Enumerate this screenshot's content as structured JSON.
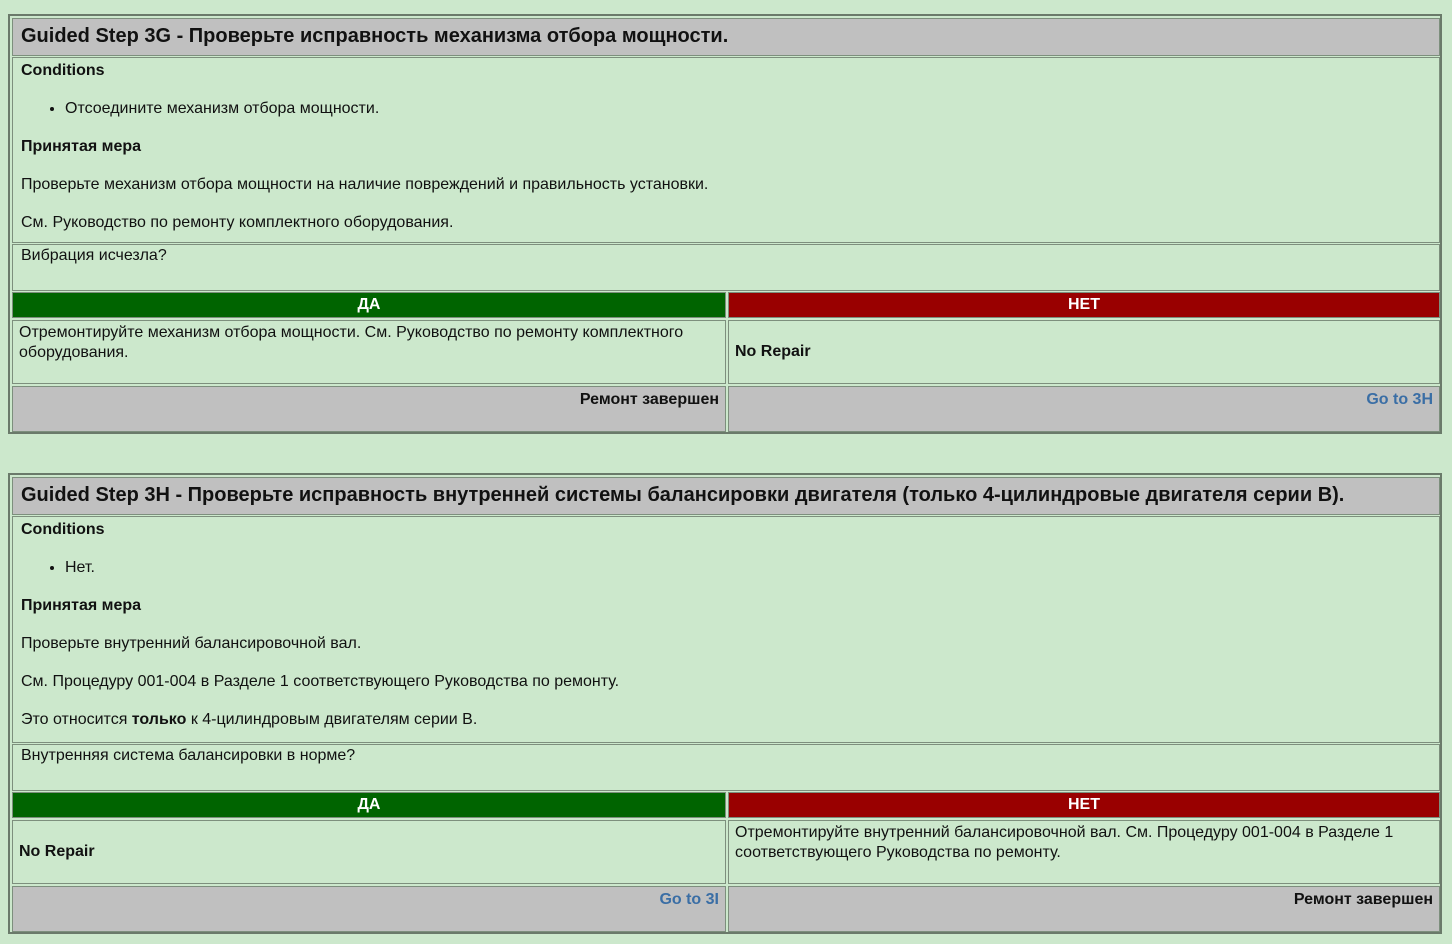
{
  "steps": [
    {
      "title": "Guided Step 3G - Проверьте исправность механизма отбора мощности.",
      "conditions_label": "Conditions",
      "conditions": [
        "Отсоедините механизм отбора мощности."
      ],
      "action_label": "Принятая мера",
      "action_lines": [
        "Проверьте механизм отбора мощности на наличие повреждений и правильность установки.",
        "См. Руководство по ремонту комплектного оборудования."
      ],
      "question": "Вибрация исчезла?",
      "yes_label": "ДА",
      "no_label": "НЕТ",
      "yes_result": "Отремонтируйте механизм отбора мощности. См. Руководство по ремонту комплектного оборудования.",
      "no_result": "No Repair",
      "yes_footer": "Ремонт завершен",
      "no_footer": "Go to 3H"
    },
    {
      "title": "Guided Step 3H - Проверьте исправность внутренней системы балансировки двигателя (только 4-цилиндровые двигателя серии B).",
      "conditions_label": "Conditions",
      "conditions": [
        "Нет."
      ],
      "action_label": "Принятая мера",
      "action_lines": [
        "Проверьте внутренний балансировочной вал.",
        "См. Процедуру 001-004 в Разделе 1 соответствующего Руководства по ремонту."
      ],
      "action_last": {
        "pre": "Это относится ",
        "bold": "только",
        "post": " к 4-цилиндровым двигателям серии B."
      },
      "question": "Внутренняя система балансировки в норме?",
      "yes_label": "ДА",
      "no_label": "НЕТ",
      "yes_result": "No Repair",
      "no_result": "Отремонтируйте внутренний балансировочной вал. См. Процедуру 001-004 в Разделе 1 соответствующего Руководства по ремонту.",
      "yes_footer": "Go to 3I",
      "no_footer": "Ремонт завершен"
    }
  ]
}
